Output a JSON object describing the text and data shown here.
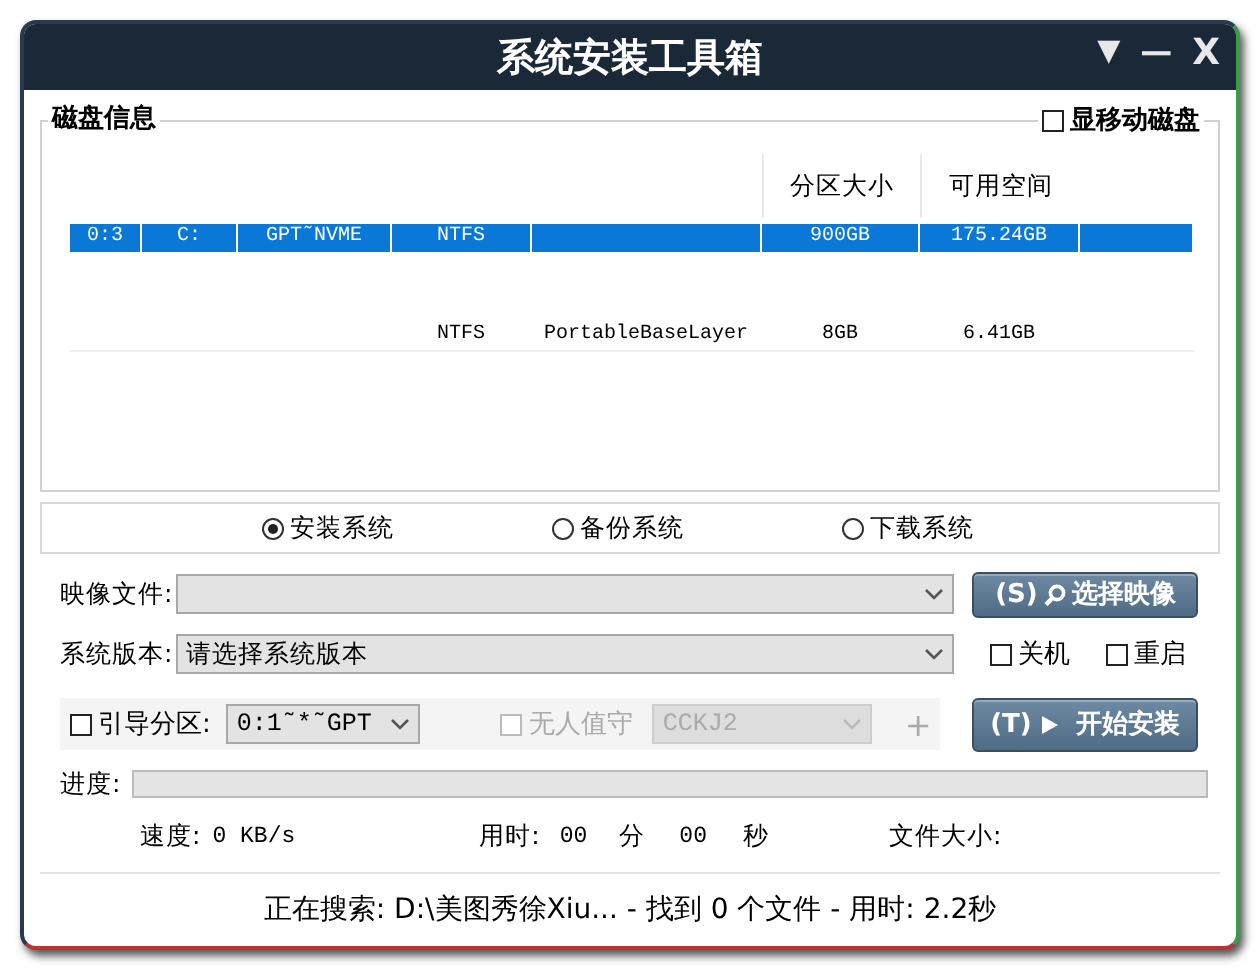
{
  "window": {
    "title": "系统安装工具箱",
    "controls": [
      {
        "kind": "menu",
        "label": "▼"
      },
      {
        "kind": "minimize",
        "label": "—"
      },
      {
        "kind": "close",
        "label": "X"
      }
    ]
  },
  "disk_panel": {
    "title": "磁盘信息",
    "show_removable": {
      "label": "显移动磁盘",
      "checked": false
    },
    "columns": [
      {
        "label": "分区大小"
      },
      {
        "label": "可用空间"
      }
    ],
    "rows": [
      {
        "selected": true,
        "column_1": "0:3",
        "column_2": "C:",
        "column_3": "GPT˜NVME",
        "column_4": "NTFS",
        "column_6": "900GB",
        "column_7": "175.24GB"
      },
      {
        "selected": false,
        "column_4": "NTFS",
        "column_5": "PortableBaseLayer",
        "column_6": "8GB",
        "column_7": "6.41GB"
      }
    ]
  },
  "modes": [
    {
      "label": "安装系统",
      "selected": true
    },
    {
      "label": "备份系统",
      "selected": false
    },
    {
      "label": "下载系统",
      "selected": false
    }
  ],
  "image_file": {
    "label": "映像文件:"
  },
  "select_image_button": {
    "hotkey": "(S)",
    "label": "选择映像"
  },
  "system_version": {
    "label": "系统版本:",
    "value": "请选择系统版本"
  },
  "after_options": [
    {
      "label": "关机",
      "checked": false
    },
    {
      "label": "重启",
      "checked": false
    }
  ],
  "boot_partition": {
    "label": "引导分区:",
    "checked": false,
    "value": "0:1˜*˜GPT"
  },
  "unattended": {
    "label": "无人值守",
    "checked": false,
    "disabled": true,
    "value": "CCKJ2",
    "add": "+"
  },
  "start_button": {
    "hotkey": "(T)",
    "label": "开始安装"
  },
  "progress": {
    "label": "进度:",
    "level": 0
  },
  "stats": {
    "speed_label": "速度:",
    "speed": "0 KB/s",
    "time_label": "用时:",
    "minutes": "00",
    "minutes_unit": "分",
    "seconds": "00",
    "seconds_unit": "秒",
    "size_label": "文件大小:"
  },
  "status_bar": "正在搜索: D:\\美图秀徐Xiu... - 找到 0 个文件 - 用时: 2.2秒"
}
